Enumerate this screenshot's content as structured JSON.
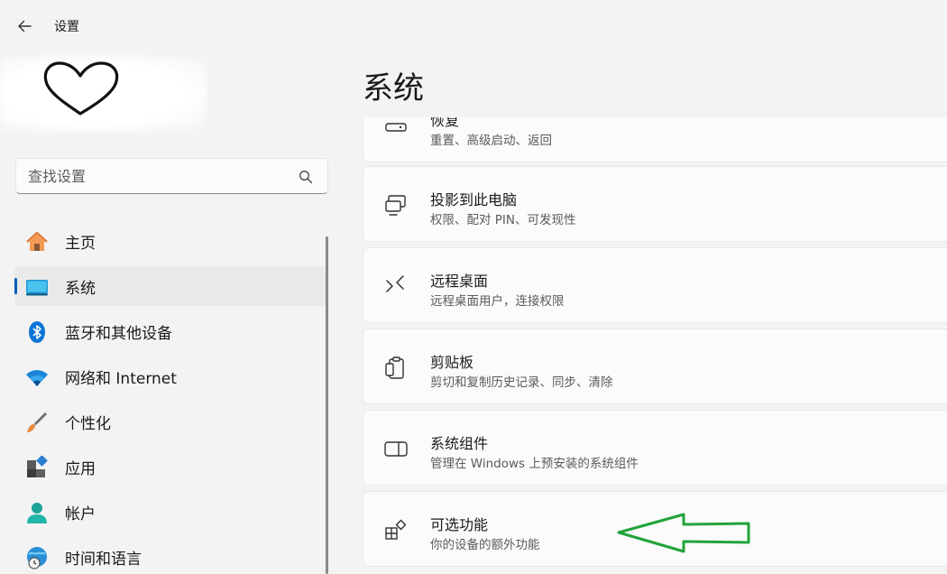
{
  "titlebar": {
    "title": "设置"
  },
  "search": {
    "placeholder": "查找设置"
  },
  "sidebar": {
    "items": [
      {
        "label": "主页",
        "icon": "home-icon",
        "selected": false
      },
      {
        "label": "系统",
        "icon": "system-icon",
        "selected": true
      },
      {
        "label": "蓝牙和其他设备",
        "icon": "bluetooth-icon",
        "selected": false
      },
      {
        "label": "网络和 Internet",
        "icon": "wifi-icon",
        "selected": false
      },
      {
        "label": "个性化",
        "icon": "brush-icon",
        "selected": false
      },
      {
        "label": "应用",
        "icon": "apps-icon",
        "selected": false
      },
      {
        "label": "帐户",
        "icon": "account-icon",
        "selected": false
      },
      {
        "label": "时间和语言",
        "icon": "globe-clock-icon",
        "selected": false
      }
    ]
  },
  "main": {
    "title": "系统",
    "cards": [
      {
        "title": "恢复",
        "subtitle": "重置、高级启动、返回",
        "icon": "recovery-icon"
      },
      {
        "title": "投影到此电脑",
        "subtitle": "权限、配对 PIN、可发现性",
        "icon": "project-icon"
      },
      {
        "title": "远程桌面",
        "subtitle": "远程桌面用户，连接权限",
        "icon": "remote-desktop-icon"
      },
      {
        "title": "剪贴板",
        "subtitle": "剪切和复制历史记录、同步、清除",
        "icon": "clipboard-icon"
      },
      {
        "title": "系统组件",
        "subtitle": "管理在 Windows 上预安装的系统组件",
        "icon": "system-components-icon"
      },
      {
        "title": "可选功能",
        "subtitle": "你的设备的额外功能",
        "icon": "optional-features-icon"
      }
    ]
  },
  "colors": {
    "accent": "#005fb8",
    "arrow": "#22a33a",
    "background": "#f3f3f3",
    "card": "#fbfbfb"
  }
}
